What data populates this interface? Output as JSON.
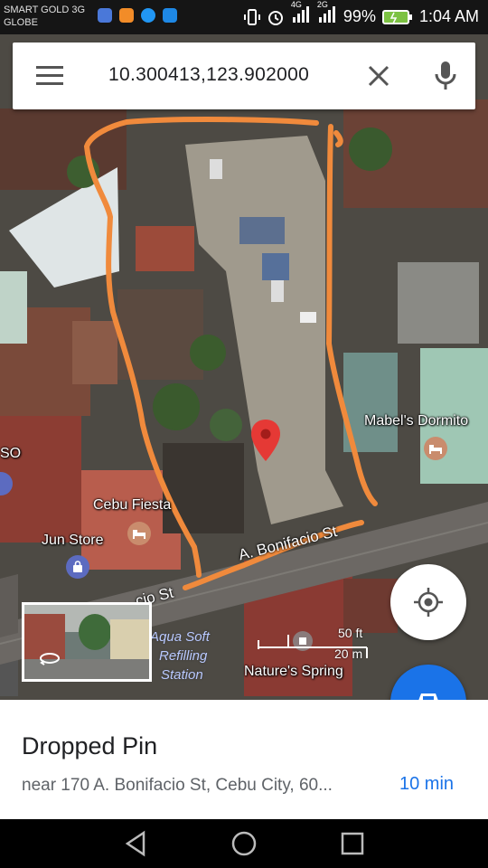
{
  "status_bar": {
    "carrier_line1": "SMART GOLD 3G",
    "carrier_line2": "GLOBE",
    "network_4g": "4G",
    "network_2g": "2G",
    "battery": "99%",
    "time": "1:04 AM"
  },
  "search": {
    "query": "10.300413,123.902000"
  },
  "map": {
    "labels": {
      "mabels": "Mabel's Dormito",
      "cebu_fiesta": "Cebu Fiesta",
      "jun_store": "Jun Store",
      "aqua_soft_line1": "Aqua Soft",
      "aqua_soft_line2": "Refilling",
      "aqua_soft_line3": "Station",
      "natures_spring": "Nature's Spring",
      "so": "SO"
    },
    "streets": {
      "bonifacio": "A. Bonifacio St",
      "bonifacio_left": "cio St"
    },
    "scale": {
      "imperial": "50 ft",
      "metric": "20 m"
    },
    "colors": {
      "annotation": "#f08a3c",
      "pin": "#e53935",
      "hotel_marker": "#c98c6d",
      "store_marker": "#5c6bc0"
    }
  },
  "bottom_sheet": {
    "title": "Dropped Pin",
    "address": "near 170 A. Bonifacio St, Cebu City, 60...",
    "eta": "10 min"
  },
  "icons": {
    "menu": "menu-icon",
    "clear": "close-icon",
    "mic": "mic-icon",
    "location": "my-location-icon",
    "directions": "car-icon"
  }
}
